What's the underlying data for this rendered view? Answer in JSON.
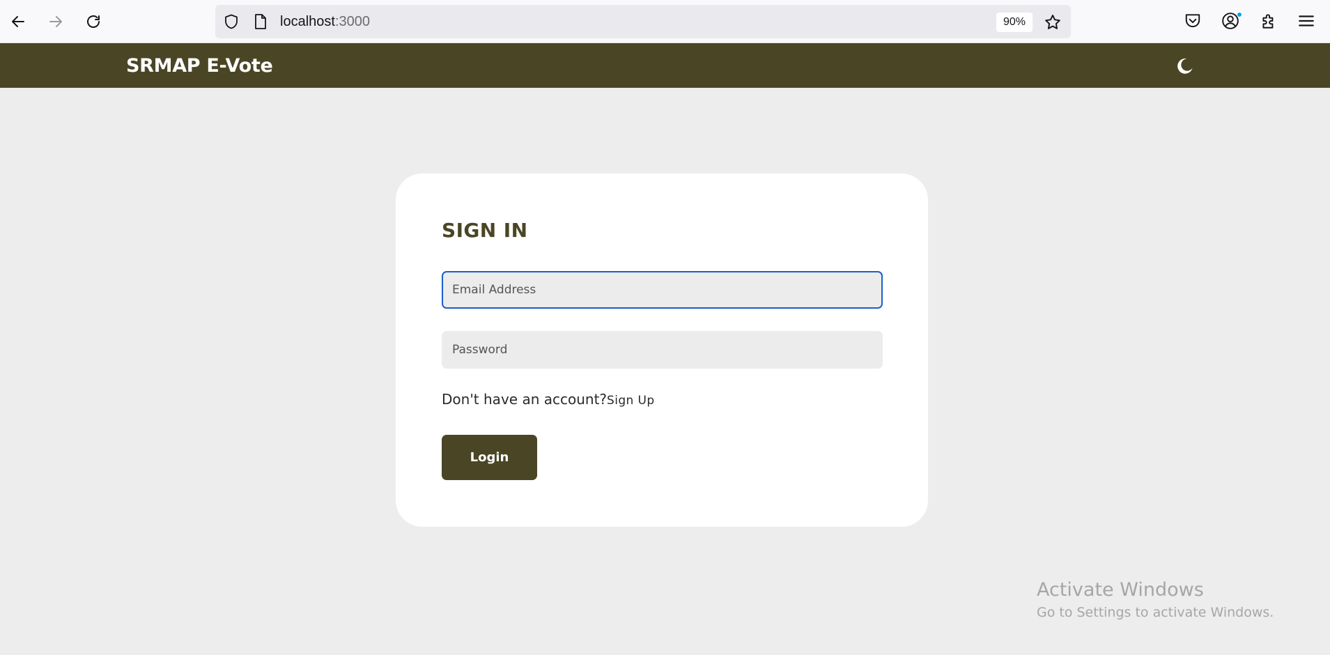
{
  "browser": {
    "url_host": "localhost",
    "url_port": ":3000",
    "zoom": "90%"
  },
  "header": {
    "brand": "SRMAP E-Vote",
    "theme_icon": "moon-icon"
  },
  "signin": {
    "title": "SIGN IN",
    "email_placeholder": "Email Address",
    "password_placeholder": "Password",
    "no_account_text": "Don't have an account?",
    "signup_link": "Sign Up",
    "login_label": "Login"
  },
  "watermark": {
    "title": "Activate Windows",
    "subtitle": "Go to Settings to activate Windows."
  },
  "colors": {
    "header_bg": "#4a4625",
    "page_bg": "#ededed",
    "focus_border": "#1b5ec9"
  }
}
